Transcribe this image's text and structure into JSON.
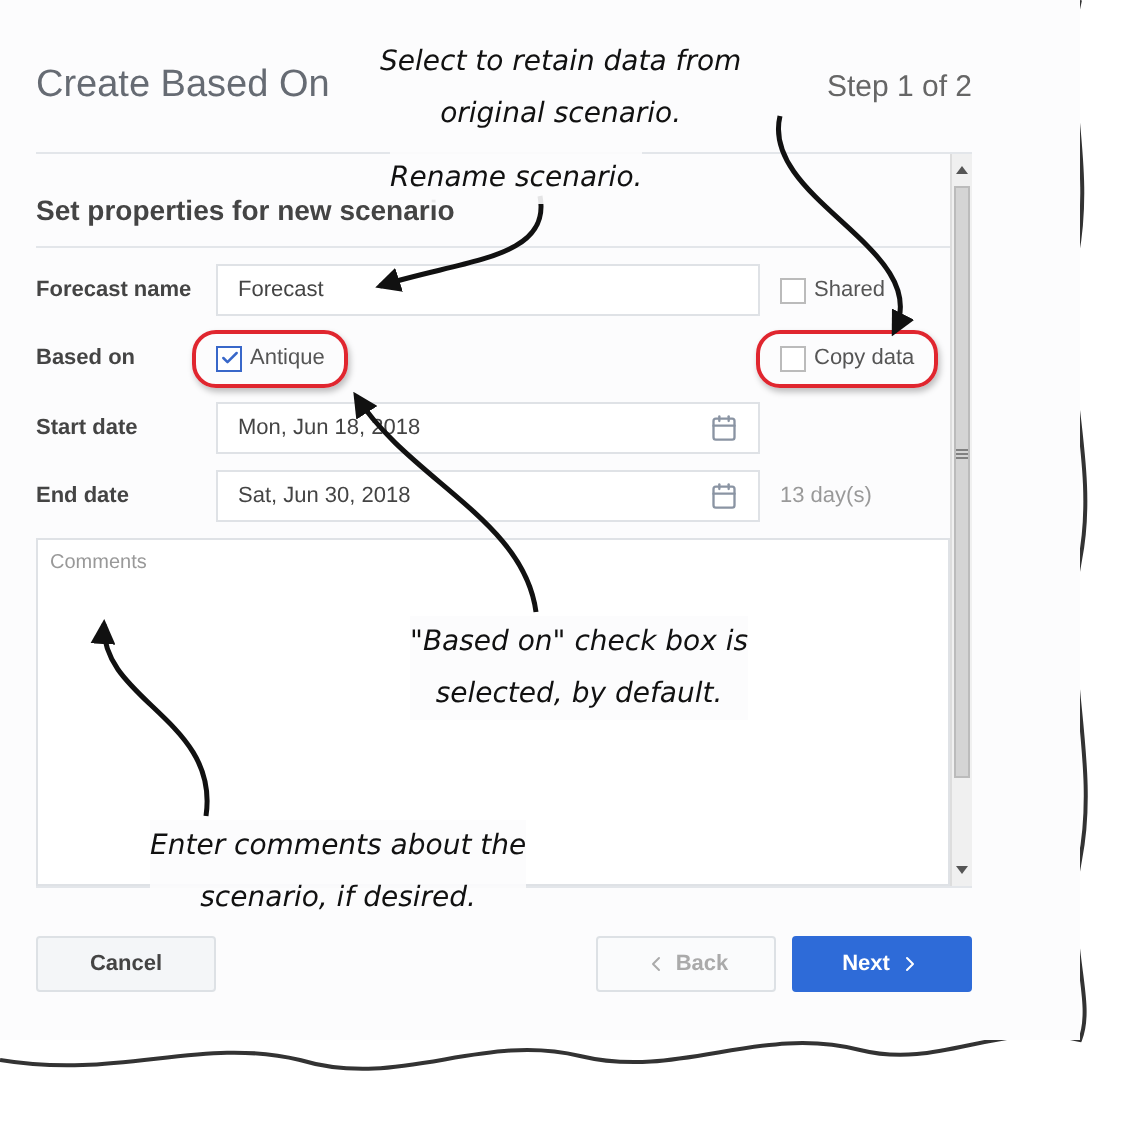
{
  "dialog": {
    "title": "Create Based On",
    "step": "Step 1 of 2"
  },
  "section": {
    "title": "Set properties for new scenario"
  },
  "form": {
    "forecast_name": {
      "label": "Forecast name",
      "value": "Forecast"
    },
    "shared": {
      "label": "Shared",
      "checked": false,
      "highlighted": false
    },
    "based_on": {
      "label": "Based on",
      "option": {
        "label": "Antique",
        "checked": true,
        "highlighted": true
      }
    },
    "copy_data": {
      "label": "Copy data",
      "checked": false,
      "highlighted": true
    },
    "start_date": {
      "label": "Start date",
      "value": "Mon, Jun 18, 2018"
    },
    "end_date": {
      "label": "End date",
      "value": "Sat, Jun 30, 2018"
    },
    "duration": "13 day(s)",
    "comments": {
      "placeholder": "Comments"
    }
  },
  "buttons": [
    {
      "label": "Cancel",
      "kind": "plain",
      "disabled": false
    },
    {
      "label": "Back",
      "kind": "back",
      "disabled": true
    },
    {
      "label": "Next",
      "kind": "next",
      "disabled": false
    }
  ],
  "callouts": [
    {
      "lines": [
        "Select to retain data from",
        "original scenario."
      ]
    },
    {
      "lines": [
        "Rename scenario."
      ]
    },
    {
      "lines": [
        "\"Based on\" check box is",
        "selected, by default."
      ]
    },
    {
      "lines": [
        "Enter comments about the",
        "scenario, if desired."
      ]
    }
  ]
}
